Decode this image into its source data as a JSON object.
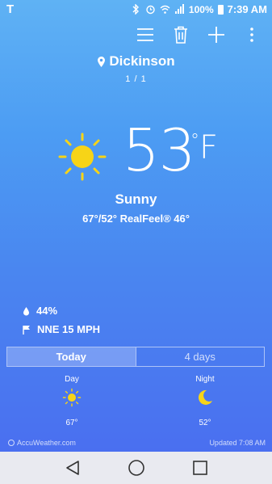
{
  "status_bar": {
    "carrier": "T",
    "battery_pct": "100%",
    "time": "7:39 AM",
    "icons": [
      "bluetooth-icon",
      "alarm-icon",
      "wifi-icon",
      "signal-icon",
      "battery-icon"
    ]
  },
  "actions": [
    "menu-icon",
    "delete-icon",
    "add-icon",
    "more-icon"
  ],
  "location": {
    "name": "Dickinson",
    "page": "1 / 1"
  },
  "current": {
    "temp": "53",
    "unit": "F",
    "degree": "°",
    "condition": "Sunny",
    "details": "67°/52° RealFeel® 46°",
    "humidity": "44%",
    "wind": "NNE 15 MPH"
  },
  "tabs": {
    "today": "Today",
    "four_days": "4 days"
  },
  "forecast": {
    "day_label": "Day",
    "day_temp": "67°",
    "night_label": "Night",
    "night_temp": "52°"
  },
  "footer": {
    "brand": "AccuWeather.com",
    "updated": "Updated 7:08 AM"
  },
  "colors": {
    "sun": "#f7d417",
    "bg_top": "#5fb2f4",
    "bg_bottom": "#4a6ff0"
  }
}
